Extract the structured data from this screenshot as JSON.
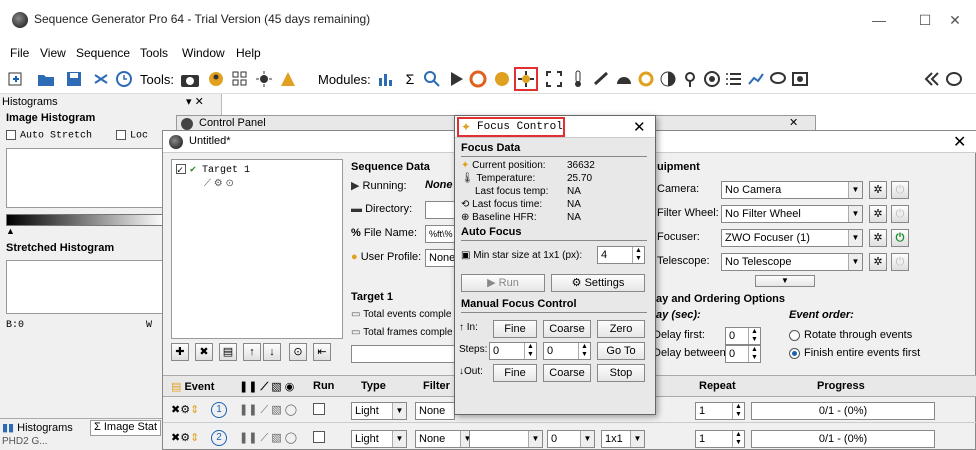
{
  "window": {
    "title": "Sequence Generator Pro 64 - Trial Version (45 days remaining)",
    "minimize": "—",
    "maximize": "☐",
    "close": "✕"
  },
  "menubar": {
    "items": [
      {
        "label": "File"
      },
      {
        "label": "View"
      },
      {
        "label": "Sequence"
      },
      {
        "label": "Tools"
      },
      {
        "label": "Window"
      },
      {
        "label": "Help"
      }
    ]
  },
  "toolbar": {
    "tools_label": "Tools:",
    "modules_label": "Modules:"
  },
  "left_dock": {
    "title": "Histograms",
    "close_glyph": "▾ ✕",
    "image_histogram": "Image Histogram",
    "auto_stretch": "Auto Stretch",
    "lock_label": "Loc",
    "stretched_histogram": "Stretched Histogram",
    "bottom_left_value": "B:0",
    "bottom_right_value": "W",
    "tabs": [
      {
        "label": "Histograms"
      },
      {
        "label": "Image Stat"
      }
    ],
    "bottom_cut": "PHD2 G..."
  },
  "control_panel_title": "Control Panel",
  "main_window": {
    "title": "Untitled*",
    "close": "✕",
    "target_tree": {
      "target_name": "Target 1"
    },
    "sequence_data": {
      "header": "Sequence Data",
      "running_label": "Running:",
      "running_value": "None",
      "directory_label": "Directory:",
      "file_name_label": "File Name:",
      "file_name_value": "%ft\\%",
      "user_profile_label": "User Profile:",
      "user_profile_value": "None"
    },
    "target_section": {
      "header": "Target 1",
      "total_events": "Total events comple",
      "total_frames": "Total frames comple"
    },
    "equipment": {
      "header": "uipment",
      "camera_label": "Camera:",
      "camera_value": "No Camera",
      "filter_wheel_label": "Filter Wheel:",
      "filter_wheel_value": "No Filter Wheel",
      "focuser_label": "Focuser:",
      "focuser_value": "ZWO Focuser (1)",
      "telescope_label": "Telescope:",
      "telescope_value": "No Telescope"
    },
    "delay_ordering": {
      "header": "lay and Ordering Options",
      "delay_header": "lay (sec):",
      "event_order_header": "Event order:",
      "delay_first_label": "Delay first:",
      "delay_first_value": "0",
      "delay_between_label": "Delay between:",
      "delay_between_value": "0",
      "rotate_label": "Rotate through events",
      "finish_label": "Finish entire events first"
    },
    "events_table": {
      "columns": {
        "event": "Event",
        "run": "Run",
        "type": "Type",
        "filter": "Filter",
        "repeat": "Repeat",
        "progress": "Progress"
      },
      "rows": [
        {
          "num": "1",
          "type": "Light",
          "filter": "None",
          "bin": "",
          "exposure": "",
          "repeat": "1",
          "progress": "0/1 - (0%)"
        },
        {
          "num": "2",
          "type": "Light",
          "filter": "None",
          "bin": "1x1",
          "exposure": "0",
          "repeat": "1",
          "progress": "0/1 - (0%)"
        }
      ]
    }
  },
  "focus_control": {
    "title": "Focus Control",
    "close": "✕",
    "focus_data_header": "Focus Data",
    "current_position_label": "Current position:",
    "current_position_value": "36632",
    "temperature_label": "Temperature:",
    "temperature_value": "25.70",
    "last_focus_temp_label": "Last focus temp:",
    "last_focus_temp_value": "NA",
    "last_focus_time_label": "Last focus time:",
    "last_focus_time_value": "NA",
    "baseline_hfr_label": "Baseline HFR:",
    "baseline_hfr_value": "NA",
    "auto_focus_header": "Auto Focus",
    "min_star_label": "Min star size at 1x1 (px):",
    "min_star_value": "4",
    "run_button": "Run",
    "settings_button": "Settings",
    "manual_header": "Manual Focus Control",
    "in_label": "In:",
    "fine_in": "Fine",
    "coarse_in": "Coarse",
    "zero_button": "Zero",
    "steps_label": "Steps:",
    "steps_value_1": "0",
    "steps_value_2": "0",
    "goto_button": "Go To",
    "out_label": "Out:",
    "fine_out": "Fine",
    "coarse_out": "Coarse",
    "stop_button": "Stop"
  },
  "colors": {
    "highlight": "#e03030",
    "accent": "#1a5fb4"
  }
}
